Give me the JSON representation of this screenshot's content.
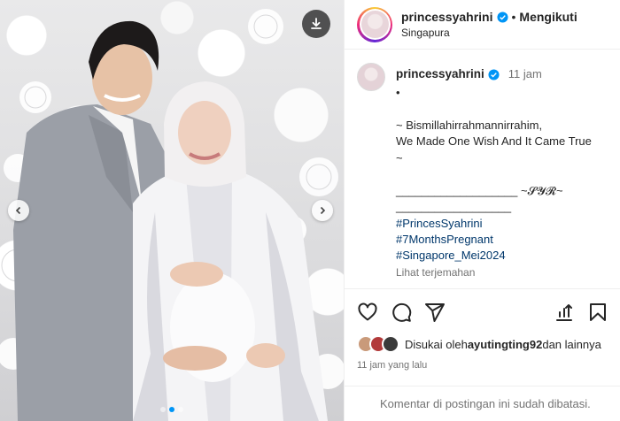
{
  "header": {
    "username": "princessyahrini",
    "separator": "•",
    "follow_label": "Mengikuti",
    "location": "Singapura"
  },
  "caption": {
    "username": "princessyahrini",
    "time": "11 jam",
    "text": "•\n\n~ Bismillahirrahmannirrahim,\nWe Made One Wish And It Came True\n~\n\n___________________ ~𝓢𝓨𝓡~\n__________________",
    "hashtags": [
      "#PrincesSyahrini",
      "#7MonthsPregnant",
      "#Singapore_Mei2024"
    ],
    "translate_label": "Lihat terjemahan"
  },
  "actions": {
    "likes_prefix": "Disukai oleh ",
    "likes_user": "ayutingting92",
    "likes_suffix": " dan lainnya",
    "posted_time": "11 jam yang lalu"
  },
  "footer": {
    "comments_disabled": "Komentar di postingan ini sudah dibatasi."
  },
  "icons": {
    "verified": "verified-badge-icon",
    "download": "download-icon",
    "like": "heart-icon",
    "comment": "comment-icon",
    "share": "share-icon",
    "insights": "insights-icon",
    "save": "bookmark-icon"
  },
  "colors": {
    "verified": "#0095f6",
    "link": "#00376b",
    "muted": "#737373",
    "border": "#efefef"
  }
}
